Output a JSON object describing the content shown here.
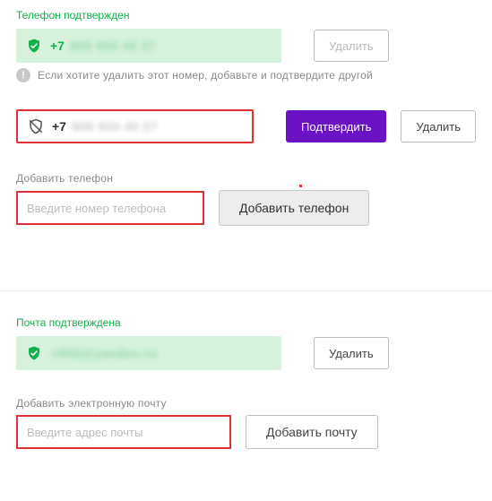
{
  "phone": {
    "confirmed": {
      "status_label": "Телефон подтвержден",
      "prefix": "+7",
      "masked": "905 934 40 27",
      "delete_label": "Удалить"
    },
    "hint": "Если хотите удалить этот номер, добавьте и подтвердите другой",
    "pending": {
      "prefix": "+7",
      "masked": "906 934 40 27",
      "confirm_label": "Подтвердить",
      "delete_label": "Удалить"
    },
    "add": {
      "label": "Добавить телефон",
      "placeholder": "Введите номер телефона",
      "button": "Добавить телефон"
    }
  },
  "email": {
    "confirmed": {
      "status_label": "Почта подтверждена",
      "masked": "v952@yandex.ru",
      "delete_label": "Удалить"
    },
    "add": {
      "label": "Добавить электронную почту",
      "placeholder": "Введите адрес почты",
      "button": "Добавить почту"
    }
  }
}
